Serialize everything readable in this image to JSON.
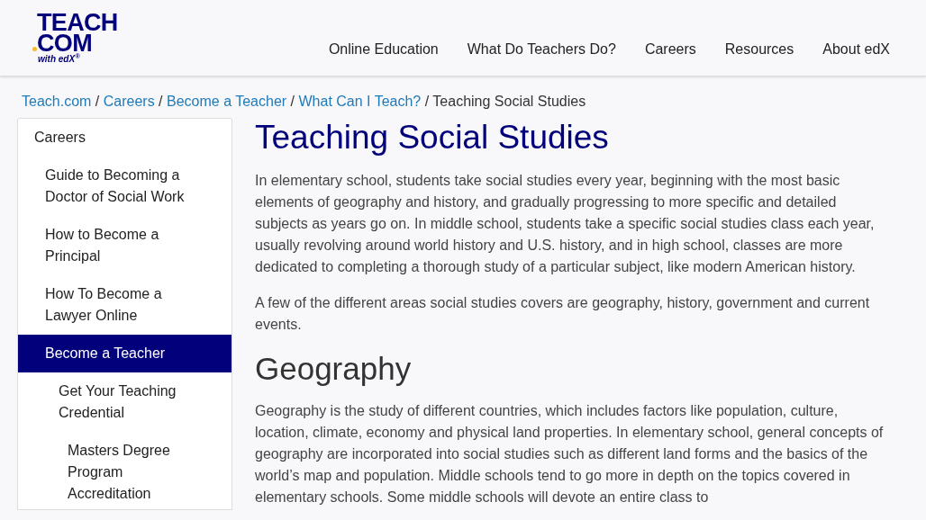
{
  "logo": {
    "line1": "TEACH",
    "line2": "COM",
    "tagline": "with edX$^{®}$"
  },
  "nav": [
    "Online Education",
    "What Do Teachers Do?",
    "Careers",
    "Resources",
    "About edX"
  ],
  "breadcrumb": [
    {
      "kind": "link",
      "text": "Teach.com"
    },
    {
      "kind": "separator",
      "text": "/"
    },
    {
      "kind": "link",
      "text": "Careers"
    },
    {
      "kind": "separator",
      "text": "/"
    },
    {
      "kind": "link",
      "text": "Become a Teacher"
    },
    {
      "kind": "separator",
      "text": "/"
    },
    {
      "kind": "link",
      "text": "What Can I Teach?"
    },
    {
      "kind": "separator",
      "text": "/"
    },
    {
      "kind": "current",
      "text": "Teaching Social Studies"
    }
  ],
  "sidebar": {
    "items": [
      {
        "label": "Careers",
        "selected": false,
        "children": [
          {
            "label": "Guide to Becoming a Doctor of Social Work",
            "selected": false
          },
          {
            "label": "How to Become a Principal",
            "selected": false
          },
          {
            "label": "How To Become a Lawyer Online",
            "selected": false
          },
          {
            "label": "Become a Teacher",
            "selected": true,
            "children": [
              {
                "label": "Get Your Teaching Credential",
                "selected": false,
                "children": [
                  {
                    "label": "Masters Degree Program Accreditation",
                    "selected": false
                  }
                ]
              }
            ]
          }
        ]
      }
    ]
  },
  "article": {
    "title": "Teaching Social Studies",
    "sections": [
      {
        "kind": "paragraph",
        "text": "In elementary school, students take social studies every year, beginning with the most basic elements of geography and history, and gradually progressing to more specific and detailed subjects as years go on. In middle school, students take a specific social studies class each year, usually revolving around world history and U.S. history, and in high school, classes are more dedicated to completing a thorough study of a particular subject, like modern American history."
      },
      {
        "kind": "paragraph",
        "text": "A few of the different areas social studies covers are geography, history, government and current events."
      },
      {
        "kind": "heading",
        "text": "Geography"
      },
      {
        "kind": "paragraph",
        "text": "Geography is the study of different countries, which includes factors like population, culture, location, climate, economy and physical land properties. In elementary school, general concepts of geography are incorporated into social studies such as different land forms and the basics of the world’s map and population. Middle schools tend to go more in depth on the topics covered in elementary schools. Some middle schools will devote an entire class to"
      }
    ]
  }
}
